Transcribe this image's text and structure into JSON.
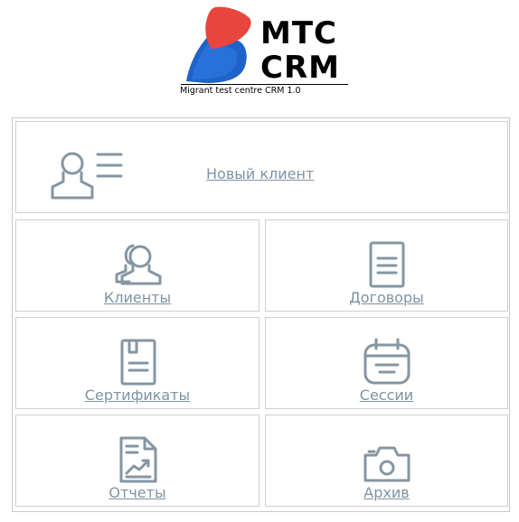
{
  "app": {
    "logo_line1": "MTC",
    "logo_line2": "CRM",
    "logo_subtitle": "Migrant test centre CRM 1.0",
    "logo_colors": {
      "red": "#e8453c",
      "blue": "#1f63c9"
    }
  },
  "menu": {
    "new_client": {
      "label": "Новый клиент",
      "icon": "user-list-icon"
    },
    "clients": {
      "label": "Клиенты",
      "icon": "users-icon"
    },
    "contracts": {
      "label": "Договоры",
      "icon": "document-icon"
    },
    "certificates": {
      "label": "Сертификаты",
      "icon": "certificate-icon"
    },
    "sessions": {
      "label": "Сессии",
      "icon": "calendar-icon"
    },
    "reports": {
      "label": "Отчеты",
      "icon": "report-chart-icon"
    },
    "archive": {
      "label": "Архив",
      "icon": "camera-icon"
    }
  },
  "theme": {
    "icon_color": "#8596a2",
    "link_color": "#7e93a3",
    "border_color": "#cfcfcf"
  }
}
